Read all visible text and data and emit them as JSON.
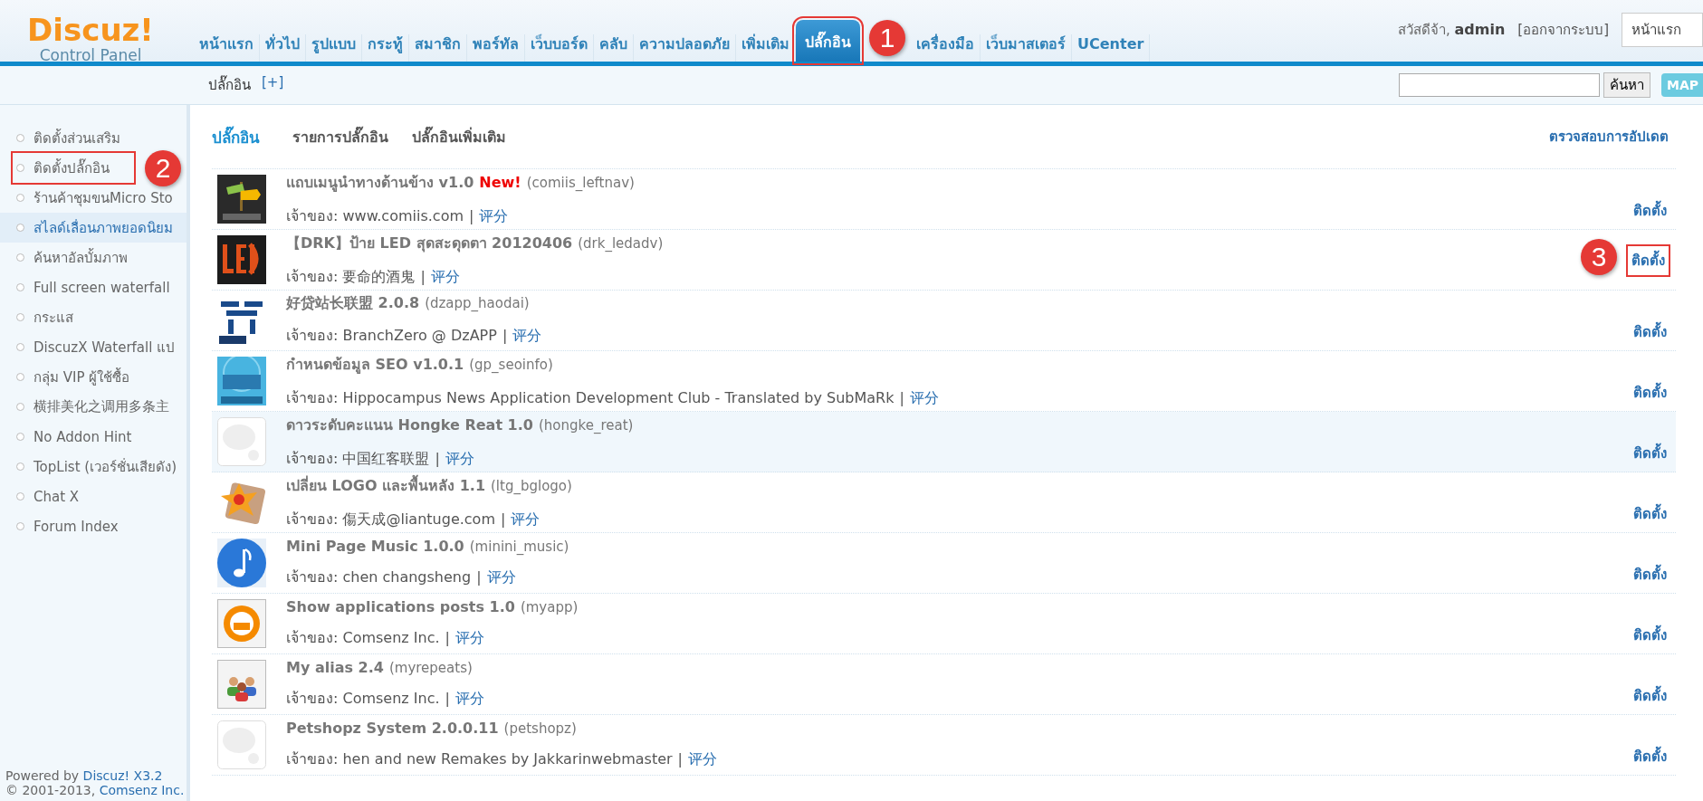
{
  "logo": {
    "title": "Discuz!",
    "subtitle": "Control Panel"
  },
  "nav": [
    {
      "label": "หน้าแรก",
      "selected": false
    },
    {
      "label": "ทั่วไป",
      "selected": false
    },
    {
      "label": "รูปแบบ",
      "selected": false
    },
    {
      "label": "กระทู้",
      "selected": false
    },
    {
      "label": "สมาชิก",
      "selected": false
    },
    {
      "label": "พอร์ทัล",
      "selected": false
    },
    {
      "label": "เว็บบอร์ด",
      "selected": false
    },
    {
      "label": "คลับ",
      "selected": false
    },
    {
      "label": "ความปลอดภัย",
      "selected": false
    },
    {
      "label": "เพิ่มเติม",
      "selected": false
    },
    {
      "label": "ปลั๊กอิน",
      "selected": true,
      "annotation": "1"
    },
    {
      "label": "เครื่องมือ",
      "selected": false
    },
    {
      "label": "เว็บมาสเตอร์",
      "selected": false
    },
    {
      "label": "UCenter",
      "selected": false
    }
  ],
  "user": {
    "greeting": "สวัสดีจ้า,",
    "name": "admin",
    "logout": "[ออกจากระบบ]",
    "home_button": "หน้าแรก"
  },
  "breadcrumb": {
    "label": "ปลั๊กอิน",
    "add": "[+]"
  },
  "search": {
    "button": "ค้นหา",
    "map_button": "MAP"
  },
  "sidebar": {
    "items": [
      {
        "label": "ติดตั้งส่วนเสริม",
        "selected": false
      },
      {
        "label": "ติดตั้งปลั๊กอิน",
        "selected": false,
        "annotation": "2"
      },
      {
        "label": "ร้านค้าชุมขนMicro Sto",
        "selected": false
      },
      {
        "label": "สไลด์เลื่อนภาพยอดนิยม",
        "selected": true
      },
      {
        "label": "ค้นหาอัลบั้มภาพ",
        "selected": false
      },
      {
        "label": "Full screen waterfall",
        "selected": false
      },
      {
        "label": "กระแส",
        "selected": false
      },
      {
        "label": "DiscuzX Waterfall แป",
        "selected": false
      },
      {
        "label": "กลุ่ม VIP ผู้ใช้ซื้อ",
        "selected": false
      },
      {
        "label": "横排美化之调用多条主",
        "selected": false
      },
      {
        "label": "No Addon Hint",
        "selected": false
      },
      {
        "label": "TopList (เวอร์ชั่นเสียดัง)",
        "selected": false
      },
      {
        "label": "Chat X",
        "selected": false
      },
      {
        "label": "Forum Index",
        "selected": false
      }
    ],
    "footer": {
      "powered": "Powered by",
      "product": "Discuz! X3.2",
      "copyright": "© 2001-2013,",
      "company": "Comsenz Inc."
    }
  },
  "tabs": [
    {
      "label": "ปลั๊กอิน",
      "selected": true
    },
    {
      "label": "รายการปลั๊กอิน",
      "selected": false
    },
    {
      "label": "ปลั๊กอินเพิ่มเติม",
      "selected": false
    }
  ],
  "check_updates": "ตรวจสอบการอัปเดต",
  "plugins": [
    {
      "title": "แถบเมนูนำทางด้านข้าง v1.0",
      "new": "New!",
      "id": "(comiis_leftnav)",
      "owner": "เจ้าของ: www.comiis.com",
      "sep": "|",
      "rate": "评分",
      "install": "ติดตั้ง",
      "selected": false
    },
    {
      "title": "【DRK】ป้าย LED สุดสะดุดตา 20120406",
      "id": "(drk_ledadv)",
      "owner": "เจ้าของ: 要命的酒鬼",
      "sep": "|",
      "rate": "评分",
      "install": "ติดตั้ง",
      "selected": false,
      "annotation": "3"
    },
    {
      "title": "好贷站长联盟 2.0.8",
      "id": "(dzapp_haodai)",
      "owner": "เจ้าของ: BranchZero @ DzAPP",
      "sep": "|",
      "rate": "评分",
      "install": "ติดตั้ง",
      "selected": false
    },
    {
      "title": "กำหนดข้อมูล SEO v1.0.1",
      "id": "(gp_seoinfo)",
      "owner": "เจ้าของ: Hippocampus News Application Development Club - Translated by SubMaRk",
      "sep": "|",
      "rate": "评分",
      "install": "ติดตั้ง",
      "selected": false
    },
    {
      "title": "ดาวระดับคะแนน Hongke Reat 1.0",
      "id": "(hongke_reat)",
      "owner": "เจ้าของ: 中国红客联盟",
      "sep": "|",
      "rate": "评分",
      "install": "ติดตั้ง",
      "selected": true
    },
    {
      "title": "เปลี่ยน LOGO และพื้นหลัง 1.1",
      "id": "(ltg_bglogo)",
      "owner": "เจ้าของ: 傷天成@liantuge.com",
      "sep": "|",
      "rate": "评分",
      "install": "ติดตั้ง",
      "selected": false
    },
    {
      "title": "Mini Page Music 1.0.0",
      "id": "(minini_music)",
      "owner": "เจ้าของ: chen changsheng",
      "sep": "|",
      "rate": "评分",
      "install": "ติดตั้ง",
      "selected": false
    },
    {
      "title": "Show applications posts 1.0",
      "id": "(myapp)",
      "owner": "เจ้าของ: Comsenz Inc.",
      "sep": "|",
      "rate": "评分",
      "install": "ติดตั้ง",
      "selected": false
    },
    {
      "title": "My alias 2.4",
      "id": "(myrepeats)",
      "owner": "เจ้าของ: Comsenz Inc.",
      "sep": "|",
      "rate": "评分",
      "install": "ติดตั้ง",
      "selected": false
    },
    {
      "title": "Petshopz System 2.0.0.11",
      "id": "(petshopz)",
      "owner": "เจ้าของ: hen and new Remakes by Jakkarinwebmaster",
      "sep": "|",
      "rate": "评分",
      "install": "ติดตั้ง",
      "selected": false
    }
  ]
}
